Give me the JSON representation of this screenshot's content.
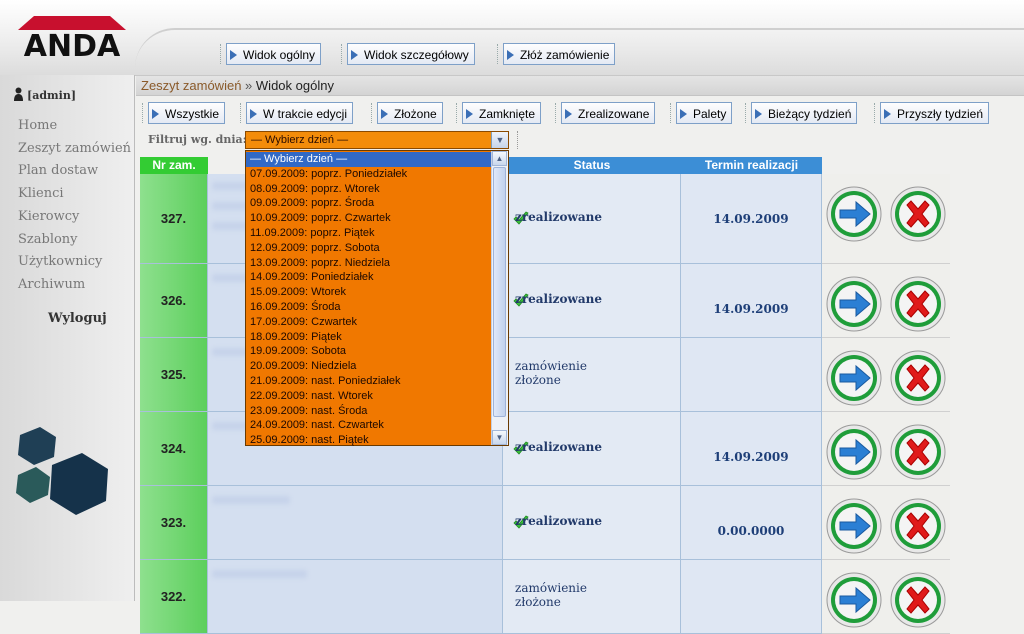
{
  "brand": {
    "logo_text": "ANDA"
  },
  "top_toolbar": [
    {
      "label": "Widok ogólny"
    },
    {
      "label": "Widok szczegółowy"
    },
    {
      "label": "Złóż zamówienie"
    }
  ],
  "sidebar": {
    "user": "[admin]",
    "items": [
      "Home",
      "Zeszyt zamówień",
      "Plan dostaw",
      "Klienci",
      "Kierowcy",
      "Szablony",
      "Użytkownicy",
      "Archiwum"
    ],
    "logout": "Wyloguj"
  },
  "breadcrumb": {
    "section": "Zeszyt zamówień",
    "separator": "»",
    "current": "Widok ogólny"
  },
  "filter_tabs": [
    "Wszystkie",
    "W trakcie edycji",
    "Złożone",
    "Zamknięte",
    "Zrealizowane",
    "Palety",
    "Bieżący tydzień",
    "Przyszły tydzień"
  ],
  "filter": {
    "label": "Filtruj wg. dnia:",
    "selected": "— Wybierz dzień —"
  },
  "dropdown_options": [
    "— Wybierz dzień —",
    "07.09.2009: poprz. Poniedziałek",
    "08.09.2009: poprz. Wtorek",
    "09.09.2009: poprz. Środa",
    "10.09.2009: poprz. Czwartek",
    "11.09.2009: poprz. Piątek",
    "12.09.2009: poprz. Sobota",
    "13.09.2009: poprz. Niedziela",
    "14.09.2009: Poniedziałek",
    "15.09.2009: Wtorek",
    "16.09.2009: Środa",
    "17.09.2009: Czwartek",
    "18.09.2009: Piątek",
    "19.09.2009: Sobota",
    "20.09.2009: Niedziela",
    "21.09.2009: nast. Poniedziałek",
    "22.09.2009: nast. Wtorek",
    "23.09.2009: nast. Środa",
    "24.09.2009: nast. Czwartek",
    "25.09.2009: nast. Piątek"
  ],
  "table": {
    "headers": {
      "nr": "Nr zam.",
      "status": "Status",
      "termin": "Termin realizacji"
    },
    "rows": [
      {
        "nr": "327.",
        "status": "zrealizowane",
        "done": true,
        "termin": "14.09.2009"
      },
      {
        "nr": "326.",
        "status": "zrealizowane",
        "done": true,
        "termin": "14.09.2009"
      },
      {
        "nr": "325.",
        "status": "zamówienie złożone",
        "done": false,
        "termin": ""
      },
      {
        "nr": "324.",
        "status": "zrealizowane",
        "done": true,
        "termin": "14.09.2009"
      },
      {
        "nr": "323.",
        "status": "zrealizowane",
        "done": true,
        "termin": "0.00.0000"
      },
      {
        "nr": "322.",
        "status": "zamówienie złożone",
        "done": false,
        "termin": ""
      }
    ]
  },
  "colors": {
    "accent_green": "#33cc33",
    "accent_blue": "#3c8ed6",
    "dropdown_bg": "#f07800",
    "logo_red": "#c8102e"
  },
  "icons": {
    "go": "arrow-right-icon",
    "delete": "x-icon",
    "check": "check-icon"
  }
}
